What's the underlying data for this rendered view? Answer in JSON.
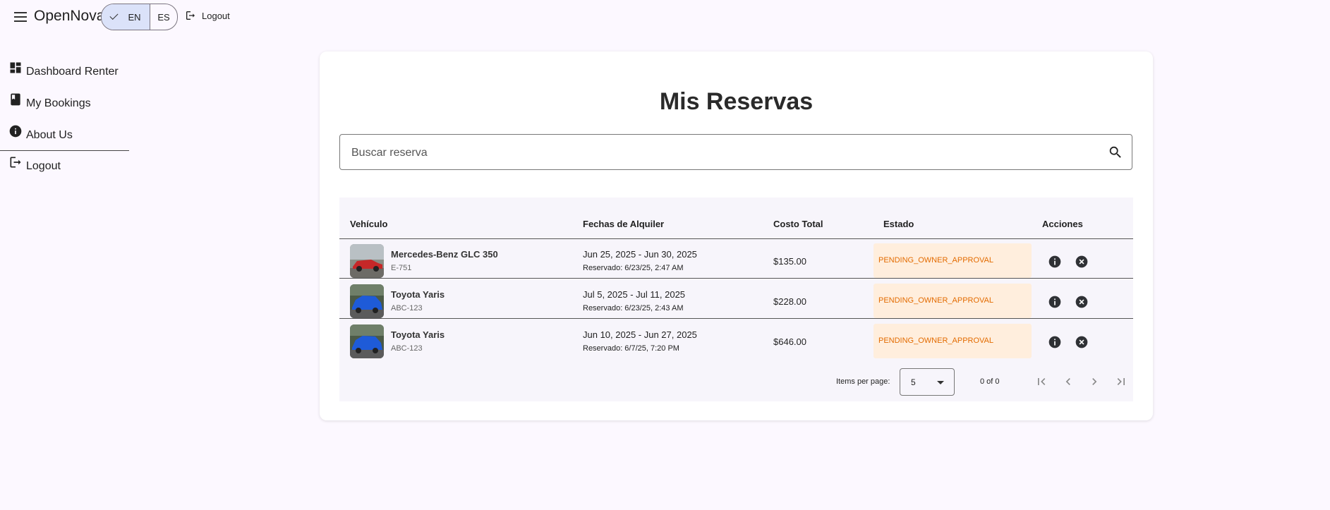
{
  "app": {
    "brand": "OpenNova",
    "languages": [
      {
        "code": "EN",
        "selected": true
      },
      {
        "code": "ES",
        "selected": false
      }
    ],
    "top_logout": "Logout"
  },
  "sidebar": {
    "items": [
      {
        "label": "Dashboard Renter",
        "icon": "dashboard-icon"
      },
      {
        "label": "My Bookings",
        "icon": "book-icon"
      },
      {
        "label": "About Us",
        "icon": "info-icon"
      },
      {
        "label": "Logout",
        "icon": "logout-icon"
      }
    ]
  },
  "main": {
    "title": "Mis Reservas",
    "search_placeholder": "Buscar reserva",
    "columns": {
      "vehicle": "Vehículo",
      "dates": "Fechas de Alquiler",
      "cost": "Costo Total",
      "status": "Estado",
      "actions": "Acciones"
    },
    "rows": [
      {
        "vehicle": "Mercedes-Benz GLC 350",
        "plate": "E-751",
        "dates": "Jun 25, 2025 - Jun 30, 2025",
        "reserved": "Reservado: 6/23/25, 2:47 AM",
        "cost": "$135.00",
        "status": "PENDING_OWNER_APPROVAL",
        "car_color": "#c62828"
      },
      {
        "vehicle": "Toyota Yaris",
        "plate": "ABC-123",
        "dates": "Jul 5, 2025 - Jul 11, 2025",
        "reserved": "Reservado: 6/23/25, 2:43 AM",
        "cost": "$228.00",
        "status": "PENDING_OWNER_APPROVAL",
        "car_color": "#1e5bd8"
      },
      {
        "vehicle": "Toyota Yaris",
        "plate": "ABC-123",
        "dates": "Jun 10, 2025 - Jun 27, 2025",
        "reserved": "Reservado: 6/7/25, 7:20 PM",
        "cost": "$646.00",
        "status": "PENDING_OWNER_APPROVAL",
        "car_color": "#1e5bd8"
      }
    ],
    "paginator": {
      "items_per_page_label": "Items per page:",
      "page_size": "5",
      "range": "0 of 0"
    }
  },
  "colors": {
    "background": "#fcf8ff",
    "lang_selected": "#dbe2f9",
    "status_bg": "#ffeedd",
    "status_text": "#e36b00"
  }
}
